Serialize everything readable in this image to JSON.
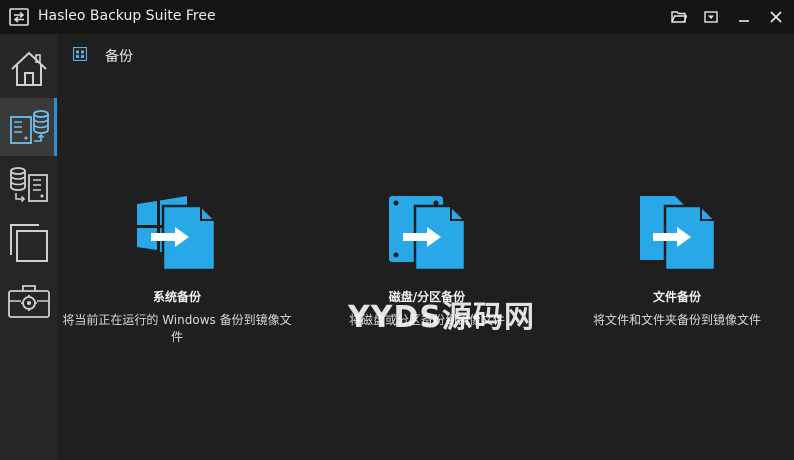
{
  "window": {
    "title": "Hasleo Backup Suite Free",
    "controls": [
      "folder-open-icon",
      "dropdown-menu-icon",
      "minimize-icon",
      "close-icon"
    ]
  },
  "sidebar": {
    "items": [
      {
        "name": "home",
        "icon": "home-icon",
        "active": false
      },
      {
        "name": "backup",
        "icon": "backup-icon",
        "active": true
      },
      {
        "name": "restore",
        "icon": "restore-icon",
        "active": false
      },
      {
        "name": "clone",
        "icon": "clone-icon",
        "active": false
      },
      {
        "name": "tools",
        "icon": "toolbox-icon",
        "active": false
      }
    ]
  },
  "header": {
    "title": "备份",
    "icon": "grid-icon"
  },
  "cards": [
    {
      "title": "系统备份",
      "description": "将当前正在运行的 Windows 备份到镜像文件",
      "icon": "windows-backup-icon"
    },
    {
      "title": "磁盘/分区备份",
      "description": "将磁盘或分区备份到镜像文件",
      "icon": "disk-backup-icon"
    },
    {
      "title": "文件备份",
      "description": "将文件和文件夹备份到镜像文件",
      "icon": "file-backup-icon"
    }
  ],
  "watermark": "YYDS源码网",
  "colors": {
    "accent": "#2b8fd8",
    "icon_blue": "#29a8e8",
    "background": "#1f1f1f",
    "titlebar": "#141414",
    "sidebar": "#262626"
  }
}
